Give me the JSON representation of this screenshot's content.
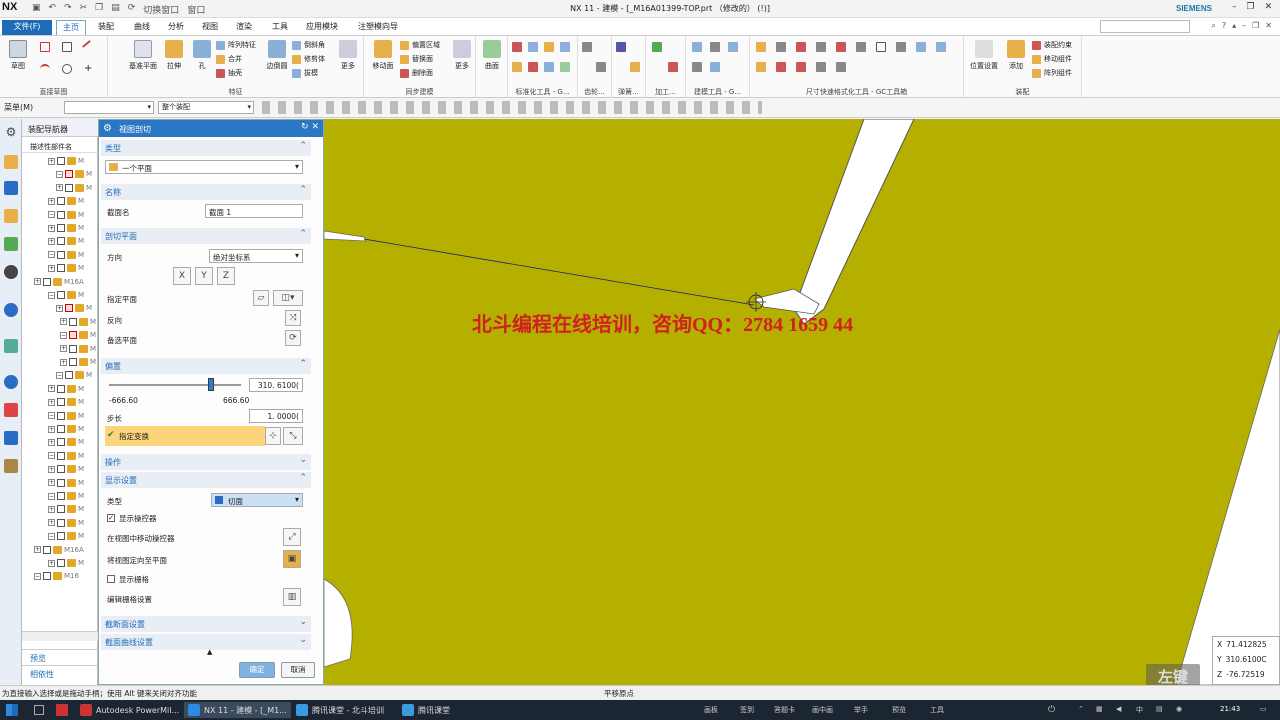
{
  "window": {
    "app_logo": "NX",
    "title": "NX 11 - 建模 - [_M16A01399-TOP.prt （修改的） (!)]",
    "brand": "SIEMENS"
  },
  "quick_menu": {
    "switch_window": "切换窗口",
    "window": "窗口"
  },
  "tabs": [
    {
      "label": "文件(F)"
    },
    {
      "label": "主页"
    },
    {
      "label": "装配"
    },
    {
      "label": "曲线"
    },
    {
      "label": "分析"
    },
    {
      "label": "视图"
    },
    {
      "label": "渲染"
    },
    {
      "label": "工具"
    },
    {
      "label": "应用模块"
    },
    {
      "label": "注塑模向导"
    }
  ],
  "ribbon": {
    "groups": {
      "direct_sketch": "直接草图",
      "feature": "特征",
      "sync_modeling": "同步建模",
      "std_tools": "标准化工具 - G...",
      "gear": "齿轮...",
      "spring": "弹簧...",
      "machining": "加工...",
      "modeling_tools": "建模工具 - G...",
      "dim_tools": "尺寸快速格式化工具 - GC工具箱",
      "assembly": "装配"
    },
    "buttons": {
      "sketch": "草图",
      "datum_plane": "基准平面",
      "extrude": "拉伸",
      "hole": "孔",
      "pattern_feature": "阵列特征",
      "unite": "合并",
      "shell": "抽壳",
      "edge_blend": "边倒圆",
      "chamfer": "倒斜角",
      "trim_body": "修剪体",
      "draft": "拔模",
      "more": "更多",
      "move_face": "移动面",
      "offset_region": "偏置区域",
      "replace_face": "替换面",
      "delete_face": "删除面",
      "more2": "更多",
      "surface": "曲面",
      "component_constraints": "装配约束",
      "move_component": "移动组件",
      "pattern_component": "阵列组件",
      "add": "添加",
      "assembly_constraint": "位置设置"
    }
  },
  "toolbar": {
    "menu": "菜单(M)",
    "filter": "",
    "scope": "整个装配"
  },
  "navigator": {
    "title": "装配导航器",
    "column": "描述性部件名",
    "rows": [
      "M",
      "M",
      "M",
      "M",
      "M",
      "M",
      "M",
      "M",
      "M",
      "M16A",
      "M",
      "M",
      "M",
      "M",
      "M",
      "M",
      "M",
      "M",
      "M",
      "M",
      "M",
      "M",
      "M",
      "M",
      "M",
      "M",
      "M",
      "M",
      "M",
      "M16A",
      "M",
      "M16"
    ],
    "preview": "预览",
    "dependency": "相依性"
  },
  "dialog": {
    "title": "视图剖切",
    "sec_type": "类型",
    "type_value": "一个平面",
    "sec_name": "名称",
    "name_label": "截面名",
    "name_value": "截面 1",
    "sec_plane": "剖切平面",
    "direction_label": "方向",
    "direction_value": "绝对坐标系",
    "specify_plane": "指定平面",
    "reverse": "反向",
    "alt_plane": "备选平面",
    "sec_offset": "偏置",
    "offset_value": "310. 6100(",
    "slider_min": "-666.60",
    "slider_max": "666.60",
    "slider_fraction": 0.77,
    "step_label": "步长",
    "step_value": "1. 0000(",
    "specify_transform": "指定变换",
    "sec_operation": "操作",
    "sec_display": "显示设置",
    "display_type_label": "类型",
    "display_type_value": "切面",
    "show_manipulator": "显示操控器",
    "move_manip": "在视图中移动操控器",
    "orient_view": "将视图定向至平面",
    "show_grid": "显示栅格",
    "edit_grid": "编辑栅格设置",
    "sec_section_settings": "截断面设置",
    "sec_curve_settings": "截面曲线设置",
    "ok": "确定",
    "cancel": "取消"
  },
  "canvas": {
    "watermark": "北斗编程在线培训，咨询QQ：2784 1659 44",
    "coord_x_label": "X",
    "coord_x": "71.412825",
    "coord_y_label": "Y",
    "coord_y": "310.6100C",
    "coord_z_label": "Z",
    "coord_z": "-76.72519",
    "logo": "左键",
    "bg_color": "#b5b000"
  },
  "status": {
    "left": "为直接输入选择或是拖动手柄；使用 Alt 键来关闭对齐功能",
    "center": "平移原点"
  },
  "taskbar": {
    "apps": [
      "Autodesk PowerMil...",
      "NX 11 - 建模 - [_M1...",
      "腾讯课堂 - 北斗培训",
      "腾讯课堂"
    ],
    "tray": [
      "画板",
      "签到",
      "答题卡",
      "画中画",
      "举手",
      "预览",
      "工具"
    ],
    "ime": "中",
    "time": "21:43"
  }
}
